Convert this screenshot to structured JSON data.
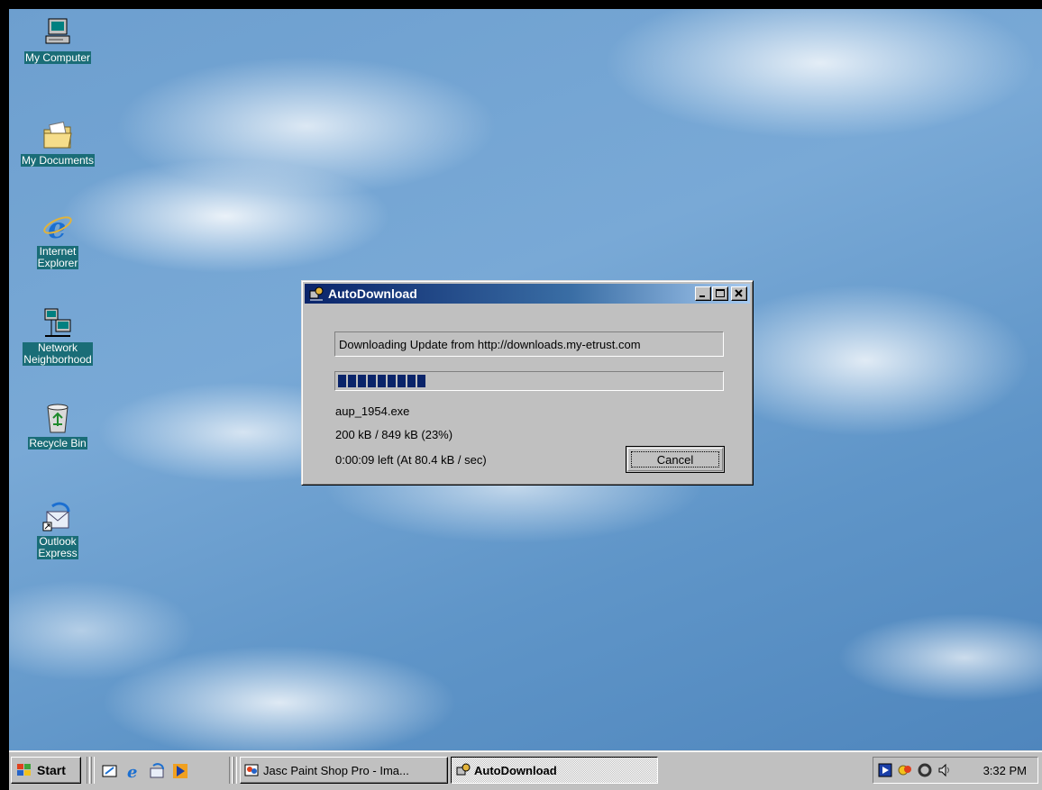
{
  "desktop": {
    "icons": [
      {
        "label": "My Computer",
        "icon": "my-computer-icon"
      },
      {
        "label": "My Documents",
        "icon": "my-documents-icon"
      },
      {
        "label_line1": "Internet",
        "label_line2": "Explorer",
        "icon": "internet-explorer-icon"
      },
      {
        "label_line1": "Network",
        "label_line2": "Neighborhood",
        "icon": "network-neighborhood-icon"
      },
      {
        "label": "Recycle Bin",
        "icon": "recycle-bin-icon"
      },
      {
        "label_line1": "Outlook",
        "label_line2": "Express",
        "icon": "outlook-express-icon"
      }
    ]
  },
  "dialog": {
    "title": "AutoDownload",
    "status_text": "Downloading Update from http://downloads.my-etrust.com",
    "progress_fraction": 0.23,
    "filename": "aup_1954.exe",
    "size_progress": "200 kB / 849 kB (23%)",
    "time_left": "0:00:09 left (At 80.4 kB / sec)",
    "cancel_label": "Cancel"
  },
  "taskbar": {
    "start_label": "Start",
    "quick_launch": [
      "show-desktop-icon",
      "internet-explorer-icon",
      "outlook-express-icon",
      "media-player-icon"
    ],
    "tasks": [
      {
        "label": "Jasc Paint Shop Pro - Ima...",
        "active": false
      },
      {
        "label": "AutoDownload",
        "active": true
      }
    ],
    "clock": "3:32 PM"
  },
  "colors": {
    "title_bar_start": "#0a246a",
    "title_bar_end": "#a6caf0",
    "progress_block": "#0a246a",
    "window_face": "#c0c0c0",
    "icon_label_bg": "#1a6d77"
  }
}
